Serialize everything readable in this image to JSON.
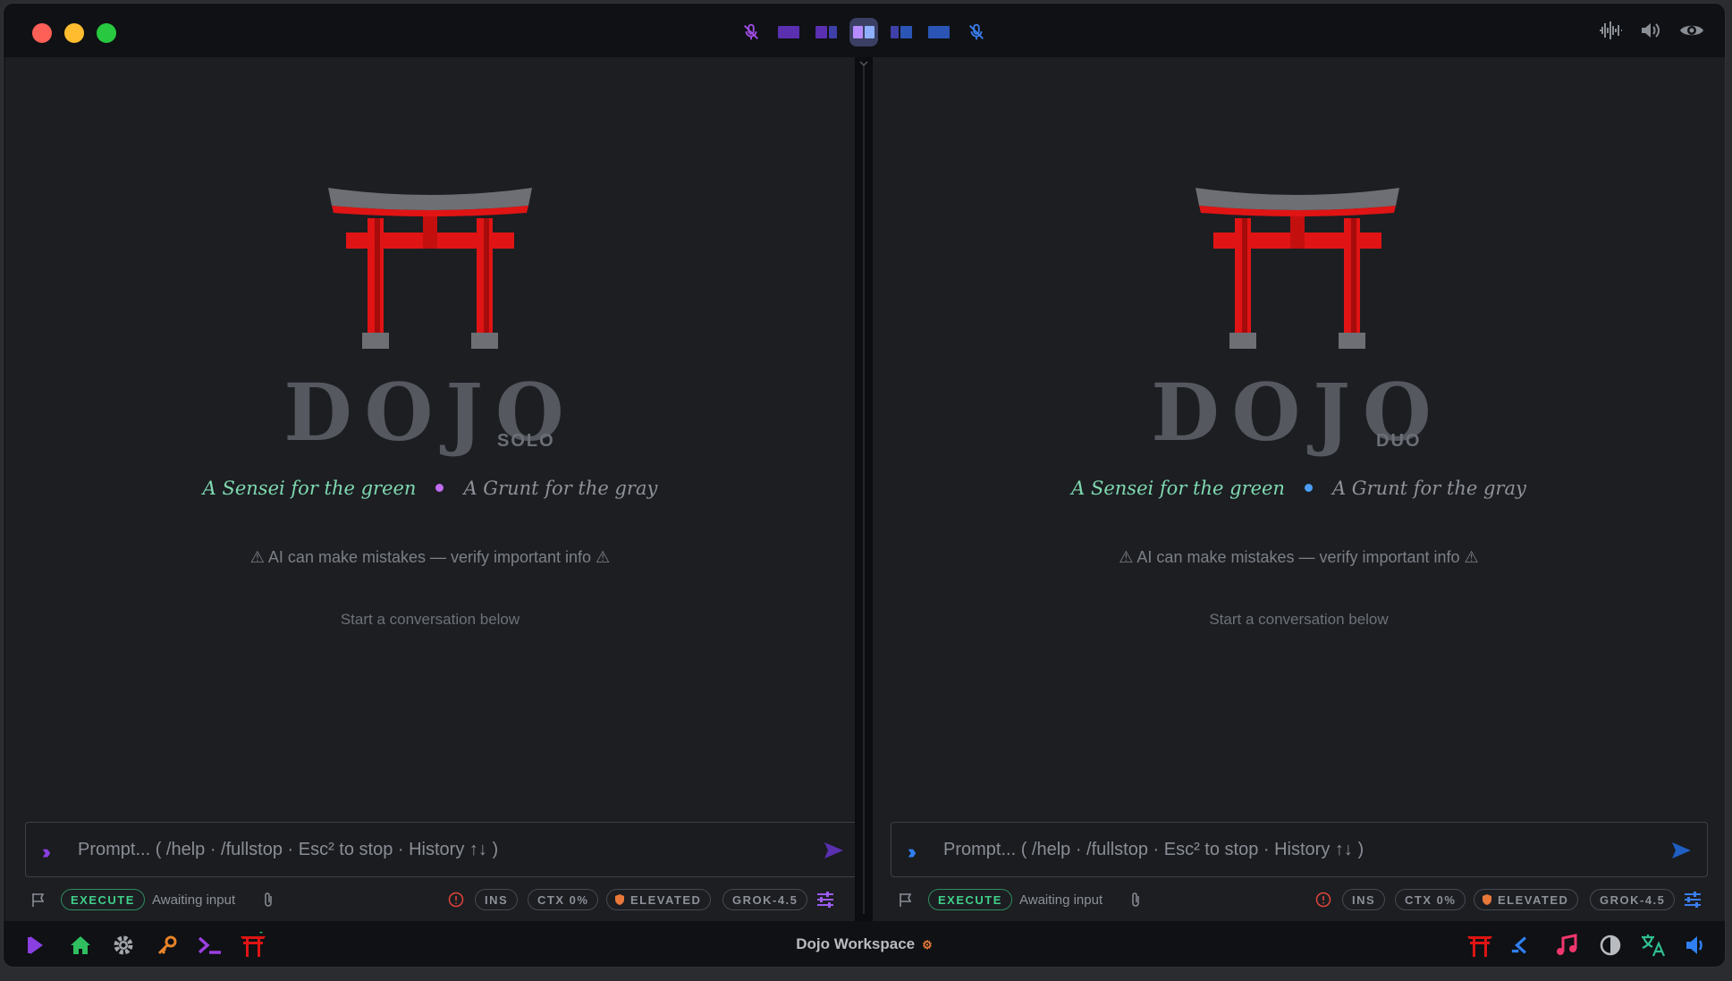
{
  "window": {
    "title": "Dojo Workspace"
  },
  "layout_bar": {
    "items": [
      "mic-off-left",
      "layout-single-left",
      "layout-split-left",
      "layout-split-equal",
      "layout-split-right",
      "layout-single-right",
      "mic-off-right"
    ],
    "active_index": 3
  },
  "panes": [
    {
      "wordmark": "DOJO",
      "subtitle": "SOLO",
      "tagline_green": "A Sensei for the green",
      "tagline_gray": "A Grunt for the gray",
      "dot_color": "#c06cf0",
      "warning": "⚠ AI can make mistakes — verify important info ⚠",
      "start": "Start a conversation below",
      "prompt_placeholder": "Prompt... ( /help · /fullstop · Esc² to stop · History ↑↓ )",
      "accent": "#8a3fe0",
      "status": {
        "execute": "EXECUTE",
        "awaiting": "Awaiting input",
        "ins": "INS",
        "ctx": "CTX 0%",
        "elevated": "ELEVATED",
        "model": "GROK-4.5"
      }
    },
    {
      "wordmark": "DOJO",
      "subtitle": "DUO",
      "tagline_green": "A Sensei for the green",
      "tagline_gray": "A Grunt for the gray",
      "dot_color": "#4a9ef5",
      "warning": "⚠ AI can make mistakes — verify important info ⚠",
      "start": "Start a conversation below",
      "prompt_placeholder": "Prompt... ( /help · /fullstop · Esc² to stop · History ↑↓ )",
      "accent": "#2f7ff0",
      "status": {
        "execute": "EXECUTE",
        "awaiting": "Awaiting input",
        "ins": "INS",
        "ctx": "CTX 0%",
        "elevated": "ELEVATED",
        "model": "GROK-4.5"
      }
    }
  ],
  "taskbar": {
    "title": "Dojo Workspace",
    "left_icons": [
      "dojo-flag-icon",
      "home-icon",
      "gear-icon",
      "key-icon",
      "terminal-icon",
      "torii-icon"
    ],
    "right_icons": [
      "torii-icon",
      "code-icon",
      "music-icon",
      "contrast-icon",
      "translate-icon",
      "speaker-icon"
    ]
  },
  "colors": {
    "torii_red": "#e01414",
    "tagline_green": "#7fd9b0",
    "execute_green": "#3fd08a"
  }
}
